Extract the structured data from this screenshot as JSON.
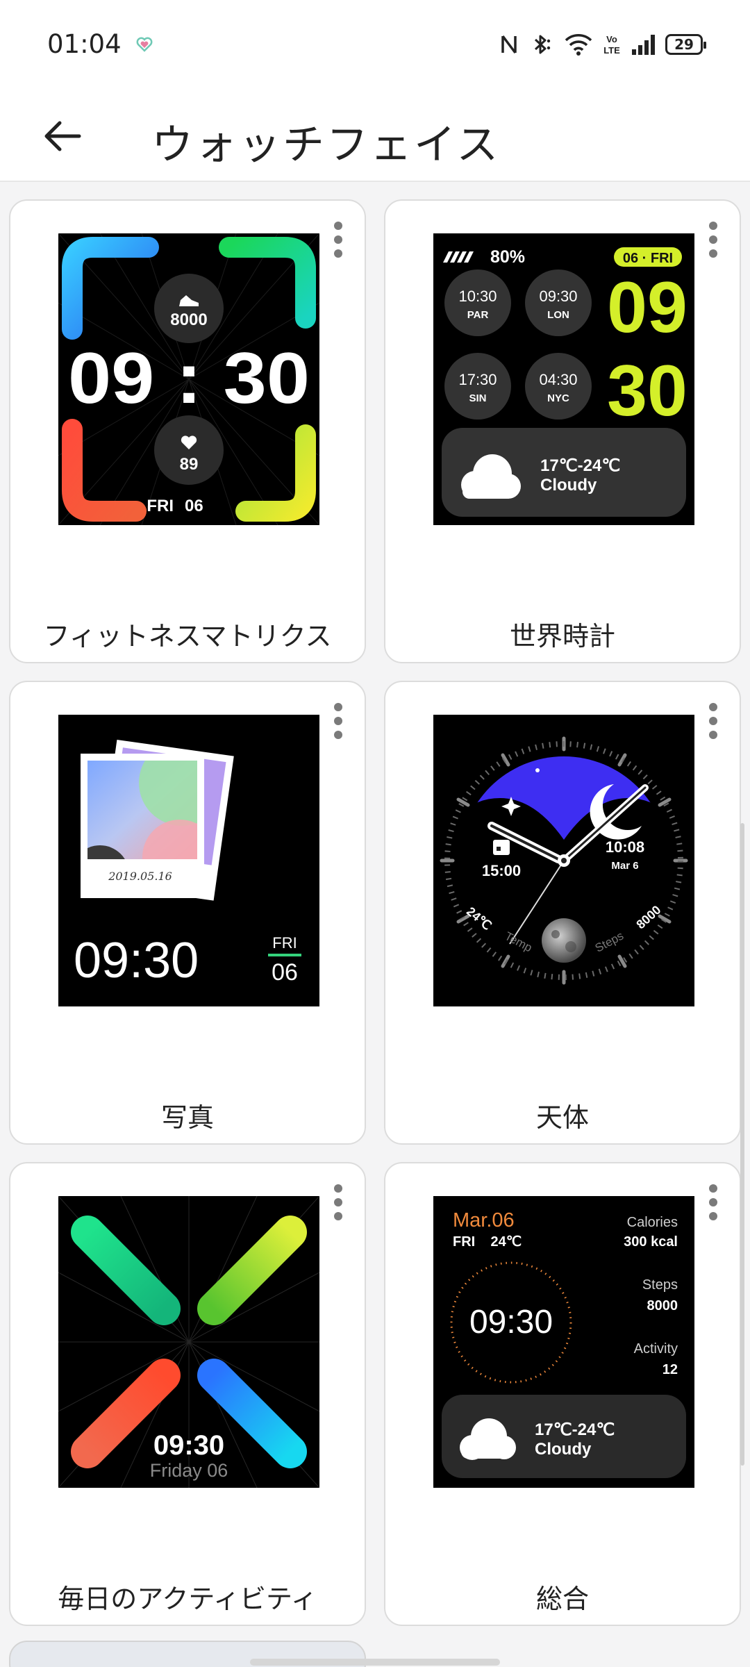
{
  "status_bar": {
    "time": "01:04",
    "battery": "29",
    "icons": [
      "heart-icon",
      "nfc-icon",
      "bluetooth-icon",
      "wifi-icon",
      "volte-icon",
      "signal-icon",
      "battery-icon"
    ]
  },
  "header": {
    "title": "ウォッチフェイス",
    "back_icon": "arrow-left-icon"
  },
  "faces": {
    "fitness": {
      "name": "フィットネスマトリクス",
      "steps": "8000",
      "time": "09 : 30",
      "heart_rate": "89",
      "day": "FRI",
      "date": "06",
      "colors": {
        "top_left": "#2aa6f5",
        "top_right": "#1ad49a",
        "bottom_left": "#f2553a",
        "bottom_right": "#c6e536"
      }
    },
    "world_clock": {
      "name": "世界時計",
      "battery": "80%",
      "date_badge": "06 · FRI",
      "hour": "09",
      "minute": "30",
      "cities": [
        {
          "time": "10:30",
          "code": "PAR"
        },
        {
          "time": "09:30",
          "code": "LON"
        },
        {
          "time": "17:30",
          "code": "SIN"
        },
        {
          "time": "04:30",
          "code": "NYC"
        }
      ],
      "temp": "17℃-24℃",
      "weather": "Cloudy",
      "accent": "#d4ef2a"
    },
    "photo": {
      "name": "写真",
      "photo_date": "2019.05.16",
      "time": "09:30",
      "day": "FRI",
      "date": "06"
    },
    "celestial": {
      "name": "天体",
      "time_left": "15:00",
      "time_right": "10:08",
      "date_right": "Mar 6",
      "temp": "24℃",
      "temp_label": "Temp",
      "steps_label": "Steps",
      "steps": "8000"
    },
    "daily_activity": {
      "name": "毎日のアクティビティ",
      "time": "09:30",
      "date": "Friday 06"
    },
    "general": {
      "name": "総合",
      "date": "Mar.06",
      "day_temp": "FRI    24℃",
      "time": "09:30",
      "calories_label": "Calories",
      "calories": "300 kcal",
      "steps_label": "Steps",
      "steps": "8000",
      "activity_label": "Activity",
      "activity": "12",
      "temp": "17℃-24℃",
      "weather": "Cloudy",
      "accent": "#f08a3c"
    }
  }
}
